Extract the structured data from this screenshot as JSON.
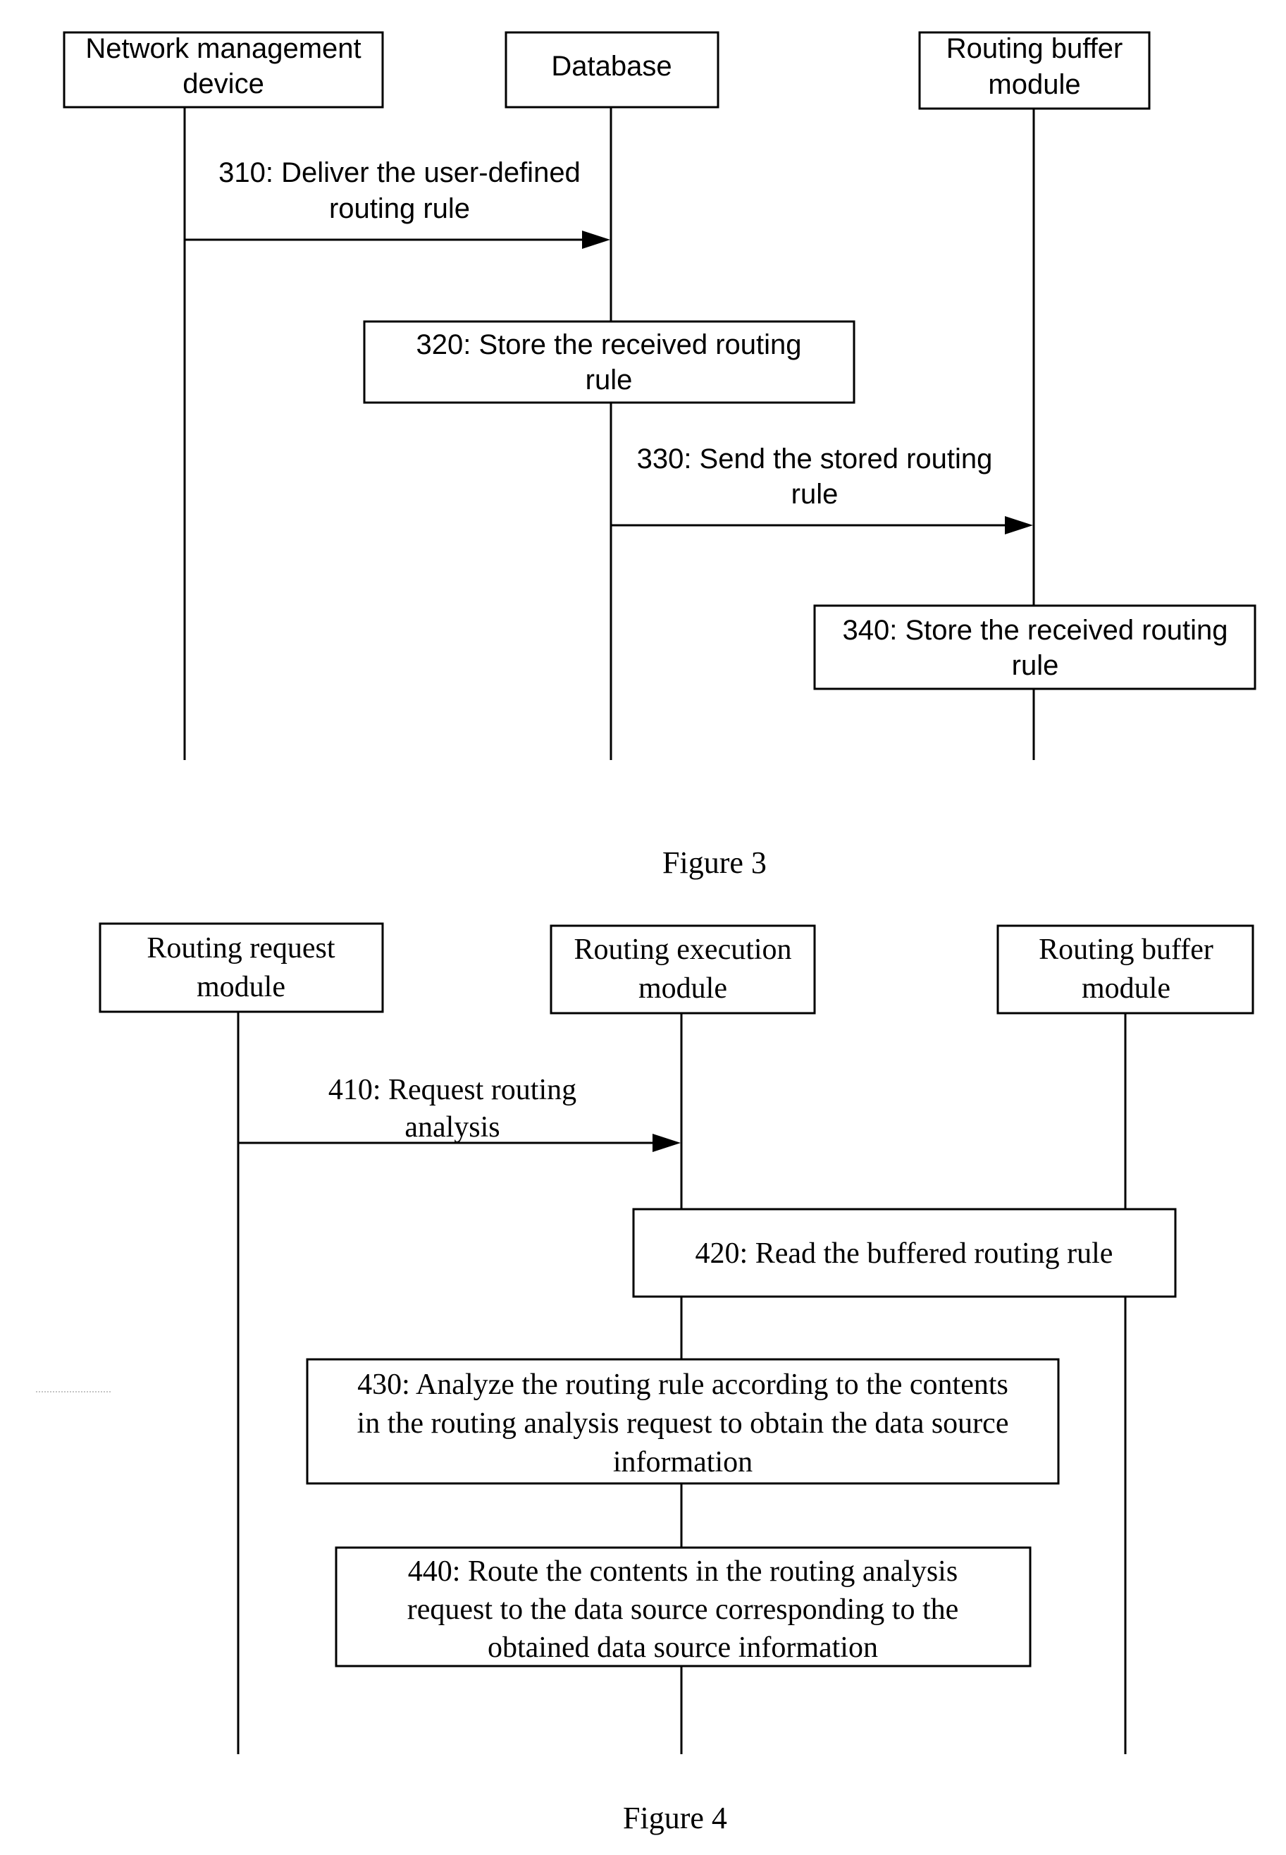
{
  "figure3": {
    "caption": "Figure 3",
    "participants": [
      {
        "id": "nmd",
        "lines": [
          "Network management",
          "device"
        ]
      },
      {
        "id": "db",
        "lines": [
          "Database"
        ]
      },
      {
        "id": "rbm",
        "lines": [
          "Routing buffer",
          "module"
        ]
      }
    ],
    "steps": [
      {
        "type": "message",
        "from": "nmd",
        "to": "db",
        "lines": [
          "310: Deliver the user-defined",
          "routing rule"
        ]
      },
      {
        "type": "action",
        "on": "db",
        "lines": [
          "320: Store the received routing",
          "rule"
        ]
      },
      {
        "type": "message",
        "from": "db",
        "to": "rbm",
        "lines": [
          "330: Send the stored routing",
          "rule"
        ]
      },
      {
        "type": "action",
        "on": "rbm",
        "lines": [
          "340: Store the received routing",
          "rule"
        ]
      }
    ]
  },
  "figure4": {
    "caption": "Figure 4",
    "participants": [
      {
        "id": "rrm",
        "lines": [
          "Routing request",
          "module"
        ]
      },
      {
        "id": "rem",
        "lines": [
          "Routing execution",
          "module"
        ]
      },
      {
        "id": "rbm",
        "lines": [
          "Routing buffer",
          "module"
        ]
      }
    ],
    "steps": [
      {
        "type": "message",
        "from": "rrm",
        "to": "rem",
        "lines": [
          "410: Request routing",
          "analysis"
        ]
      },
      {
        "type": "action",
        "on": "rem",
        "lines": [
          "420: Read the buffered routing rule"
        ]
      },
      {
        "type": "action",
        "on": "rem",
        "lines": [
          "430: Analyze the routing rule according to  the contents",
          "in the routing analysis request to obtain the data source",
          "information"
        ]
      },
      {
        "type": "action",
        "on": "rem",
        "lines": [
          "440: Route the contents in the routing analysis",
          "request to the data source corresponding to the",
          "obtained data source information"
        ]
      }
    ]
  }
}
